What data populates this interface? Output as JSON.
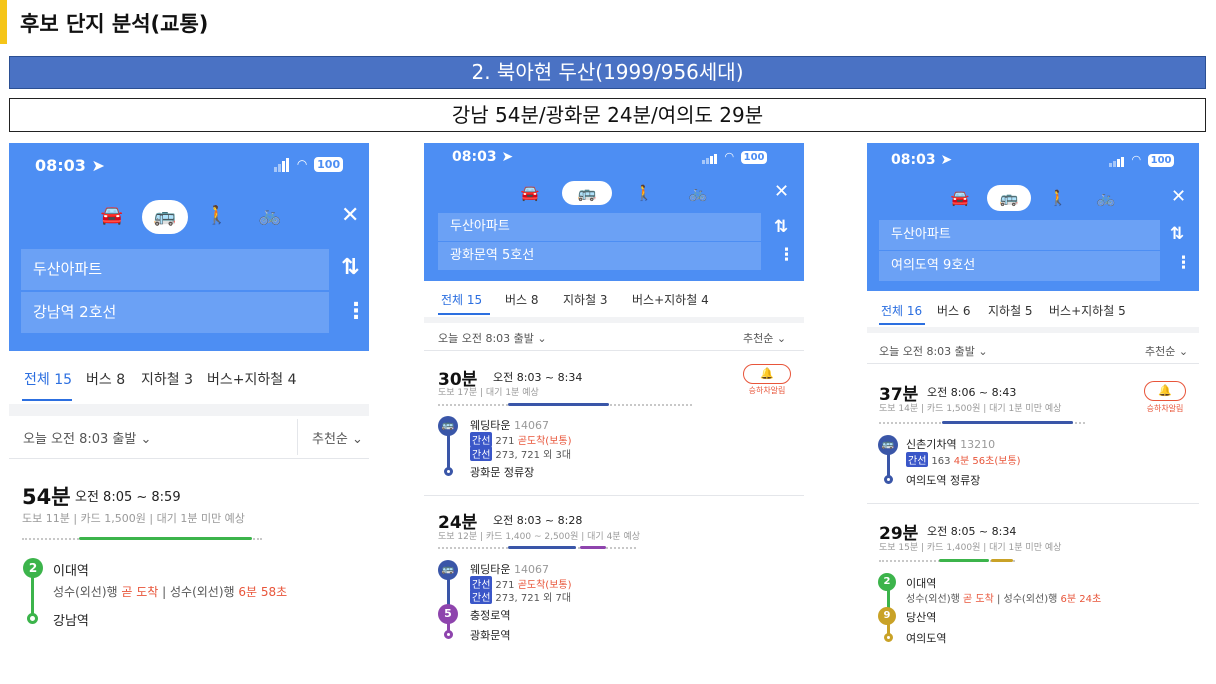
{
  "header": {
    "title": "후보 단지 분석(교통)",
    "band": "2. 북아현 두산(1999/956세대)",
    "commute": "강남 54분/광화문 24분/여의도 29분"
  },
  "colors": {
    "accent_bar": "#f5c518",
    "band": "#4a72c4",
    "app_blue": "#4d8ef3",
    "line2": "#3cb44b",
    "line5": "#8e44ad",
    "line9": "#c9a227",
    "red": "#e8553a"
  },
  "screens": [
    {
      "status": {
        "time": "08:03",
        "battery": "100"
      },
      "modes": [
        {
          "icon": "car-icon",
          "glyph": "🚘"
        },
        {
          "icon": "bus-icon",
          "glyph": "🚌"
        },
        {
          "icon": "walk-icon",
          "glyph": "🚶"
        },
        {
          "icon": "bike-icon",
          "glyph": "🚲"
        }
      ],
      "close": "✕",
      "origin": "두산아파트",
      "destination": "강남역 2호선",
      "swap": "⇅",
      "more": "⋮",
      "tabs": [
        "전체 15",
        "버스 8",
        "지하철 3",
        "버스+지하철 4"
      ],
      "depart": "오늘 오전 8:03 출발 ⌄",
      "sort": "추천순 ⌄",
      "routes": [
        {
          "duration": "54분",
          "range": "오전 8:05 ~ 8:59",
          "meta": "도보 11분 | 카드 1,500원 | 대기 1분 미만 예상",
          "board_badge": "2",
          "board_name": "이대역",
          "board_info_a": "성수(외선)행 ",
          "board_info_b": "곧 도착",
          "board_info_c": " | 성수(외선)행 ",
          "board_info_d": "6분 58초",
          "alight": "강남역"
        }
      ]
    },
    {
      "status": {
        "time": "08:03",
        "battery": "100"
      },
      "modes": [
        {
          "icon": "car-icon",
          "glyph": "🚘"
        },
        {
          "icon": "bus-icon",
          "glyph": "🚌"
        },
        {
          "icon": "walk-icon",
          "glyph": "🚶"
        },
        {
          "icon": "bike-icon",
          "glyph": "🚲"
        }
      ],
      "close": "✕",
      "origin": "두산아파트",
      "destination": "광화문역 5호선",
      "swap": "⇅",
      "more": "⋮",
      "tabs": [
        "전체 15",
        "버스 8",
        "지하철 3",
        "버스+지하철 4"
      ],
      "depart": "오늘 오전 8:03 출발 ⌄",
      "sort": "추천순 ⌄",
      "alarm_label": "승하차알림",
      "routes": [
        {
          "duration": "30분",
          "range": "오전 8:03 ~ 8:34",
          "meta": "도보 17분 | 대기 1분 예상",
          "stop": "웨딩타운",
          "stop_no": "14067",
          "tag": "간선",
          "bus_a": "271",
          "bus_a_status": "곧도착(보통)",
          "bus_b": "273, 721",
          "bus_b_extra": "외 3대",
          "alight": "광화문 정류장"
        },
        {
          "duration": "24분",
          "range": "오전 8:03 ~ 8:28",
          "meta": "도보 12분 | 카드 1,400 ~ 2,500원 | 대기 4분 예상",
          "stop": "웨딩타운",
          "stop_no": "14067",
          "tag": "간선",
          "bus_a": "271",
          "bus_a_status": "곧도착(보통)",
          "bus_b": "273, 721",
          "bus_b_extra": "외 7대",
          "transfer_badge": "5",
          "transfer": "충정로역",
          "alight": "광화문역"
        }
      ]
    },
    {
      "status": {
        "time": "08:03",
        "battery": "100"
      },
      "modes": [
        {
          "icon": "car-icon",
          "glyph": "🚘"
        },
        {
          "icon": "bus-icon",
          "glyph": "🚌"
        },
        {
          "icon": "walk-icon",
          "glyph": "🚶"
        },
        {
          "icon": "bike-icon",
          "glyph": "🚲"
        }
      ],
      "close": "✕",
      "origin": "두산아파트",
      "destination": "여의도역 9호선",
      "swap": "⇅",
      "more": "⋮",
      "tabs": [
        "전체 16",
        "버스 6",
        "지하철 5",
        "버스+지하철 5"
      ],
      "depart": "오늘 오전 8:03 출발 ⌄",
      "sort": "추천순 ⌄",
      "alarm_label": "승하차알림",
      "routes": [
        {
          "duration": "37분",
          "range": "오전 8:06 ~ 8:43",
          "meta": "도보 14분 | 카드 1,500원 | 대기 1분 미만 예상",
          "stop": "신촌기차역",
          "stop_no": "13210",
          "tag": "간선",
          "bus_a": "163",
          "bus_a_status": "4분 56초(보통)",
          "alight": "여의도역 정류장"
        },
        {
          "duration": "29분",
          "range": "오전 8:05 ~ 8:34",
          "meta": "도보 15분 | 카드 1,400원 | 대기 1분 미만 예상",
          "board_badge": "2",
          "board_name": "이대역",
          "board_info_a": "성수(외선)행 ",
          "board_info_b": "곧 도착",
          "board_info_c": " | 성수(외선)행 ",
          "board_info_d": "6분 24초",
          "transfer_badge": "9",
          "transfer": "당산역",
          "alight": "여의도역"
        }
      ]
    }
  ]
}
